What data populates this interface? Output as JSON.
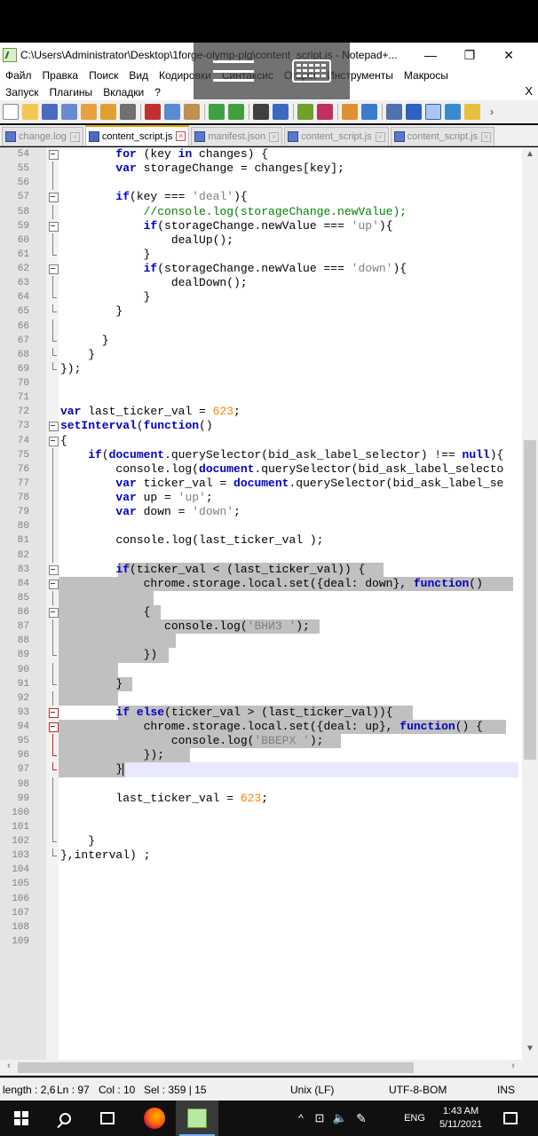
{
  "window": {
    "title": "C:\\Users\\Administrator\\Desktop\\1forge-olymp-plg\\content_script.js - Notepad+...",
    "minimize": "—",
    "maximize": "❐",
    "close": "✕"
  },
  "menu_row1": [
    "Файл",
    "Правка",
    "Поиск",
    "Вид",
    "Кодировки",
    "Синтаксис",
    "Опции",
    "Инструменты",
    "Макросы"
  ],
  "menu_row2": [
    "Запуск",
    "Плагины",
    "Вкладки",
    "?"
  ],
  "menu_close": "X",
  "tabs": [
    {
      "label": "change.log",
      "active": false
    },
    {
      "label": "content_script.js",
      "active": true
    },
    {
      "label": "manifest.json",
      "active": false
    },
    {
      "label": "content_script.js",
      "active": false
    },
    {
      "label": "content_script.js",
      "active": false
    }
  ],
  "code_lines": [
    {
      "n": "54",
      "t": "        for (key in changes) {"
    },
    {
      "n": "55",
      "t": "        var storageChange = changes[key];"
    },
    {
      "n": "56",
      "t": ""
    },
    {
      "n": "57",
      "t": "        if(key === 'deal'){"
    },
    {
      "n": "58",
      "t": "            //console.log(storageChange.newValue);"
    },
    {
      "n": "59",
      "t": "            if(storageChange.newValue === 'up'){"
    },
    {
      "n": "60",
      "t": "                dealUp();"
    },
    {
      "n": "61",
      "t": "            }"
    },
    {
      "n": "62",
      "t": "            if(storageChange.newValue === 'down'){"
    },
    {
      "n": "63",
      "t": "                dealDown();"
    },
    {
      "n": "64",
      "t": "            }"
    },
    {
      "n": "65",
      "t": "        }"
    },
    {
      "n": "66",
      "t": ""
    },
    {
      "n": "67",
      "t": "      }"
    },
    {
      "n": "68",
      "t": "    }"
    },
    {
      "n": "69",
      "t": "});"
    },
    {
      "n": "70",
      "t": ""
    },
    {
      "n": "71",
      "t": ""
    },
    {
      "n": "72",
      "t": "var last_ticker_val = 623;"
    },
    {
      "n": "73",
      "t": "setInterval(function()"
    },
    {
      "n": "74",
      "t": "{"
    },
    {
      "n": "75",
      "t": "    if(document.querySelector(bid_ask_label_selector) !== null){"
    },
    {
      "n": "76",
      "t": "        console.log(document.querySelector(bid_ask_label_selecto"
    },
    {
      "n": "77",
      "t": "        var ticker_val = document.querySelector(bid_ask_label_se"
    },
    {
      "n": "78",
      "t": "        var up = 'up';"
    },
    {
      "n": "79",
      "t": "        var down = 'down';"
    },
    {
      "n": "80",
      "t": ""
    },
    {
      "n": "81",
      "t": "        console.log(last_ticker_val );"
    },
    {
      "n": "82",
      "t": ""
    },
    {
      "n": "83",
      "t": "        if(ticker_val < (last_ticker_val)) {"
    },
    {
      "n": "84",
      "t": "            chrome.storage.local.set({deal: down}, function()"
    },
    {
      "n": "85",
      "t": ""
    },
    {
      "n": "86",
      "t": "            {"
    },
    {
      "n": "87",
      "t": "               console.log('ВНИЗ ');"
    },
    {
      "n": "88",
      "t": ""
    },
    {
      "n": "89",
      "t": "            })"
    },
    {
      "n": "90",
      "t": ""
    },
    {
      "n": "91",
      "t": "        }"
    },
    {
      "n": "92",
      "t": ""
    },
    {
      "n": "93",
      "t": "        if else(ticker_val > (last_ticker_val)){"
    },
    {
      "n": "94",
      "t": "            chrome.storage.local.set({deal: up}, function() {"
    },
    {
      "n": "95",
      "t": "                console.log('ВВЕРХ ');"
    },
    {
      "n": "96",
      "t": "            });"
    },
    {
      "n": "97",
      "t": "        }"
    },
    {
      "n": "98",
      "t": ""
    },
    {
      "n": "99",
      "t": "        last_ticker_val = 623;"
    },
    {
      "n": "100",
      "t": ""
    },
    {
      "n": "101",
      "t": ""
    },
    {
      "n": "102",
      "t": "    }"
    },
    {
      "n": "103",
      "t": "},interval) ;"
    },
    {
      "n": "104",
      "t": ""
    },
    {
      "n": "105",
      "t": ""
    },
    {
      "n": "106",
      "t": ""
    },
    {
      "n": "107",
      "t": ""
    },
    {
      "n": "108",
      "t": ""
    },
    {
      "n": "109",
      "t": ""
    }
  ],
  "status": {
    "length": "length : 2,6",
    "ln": "Ln : 97",
    "col": "Col : 10",
    "sel": "Sel : 359 | 15",
    "eol": "Unix (LF)",
    "encoding": "UTF-8-BOM",
    "mode": "INS"
  },
  "taskbar": {
    "lang": "ENG",
    "time": "1:43 AM",
    "date": "5/11/2021",
    "tray_chevron": "^"
  },
  "colors": {
    "keyword": "#0000c0",
    "comment": "#008000",
    "string": "#808080",
    "number": "#ff8000",
    "selection": "#c0c0c0",
    "active_tab_accent": "#f0a000"
  }
}
